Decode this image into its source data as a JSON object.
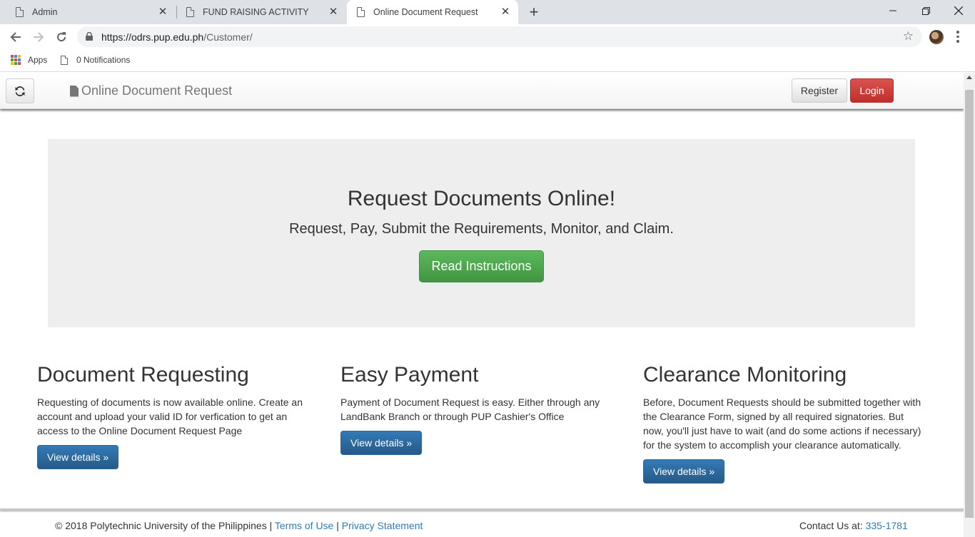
{
  "browser": {
    "tabs": [
      {
        "title": "Admin",
        "active": false
      },
      {
        "title": "FUND RAISING ACTIVITY",
        "active": false
      },
      {
        "title": "Online Document Request",
        "active": true
      }
    ],
    "url": {
      "host": "https://odrs.pup.edu.ph",
      "path": "/Customer/"
    },
    "bookmarks": {
      "apps_label": "Apps",
      "notifications_label": "0 Notifications"
    }
  },
  "navbar": {
    "brand": "Online Document Request",
    "register_label": "Register",
    "login_label": "Login"
  },
  "hero": {
    "title": "Request Documents Online!",
    "subtitle": "Request, Pay, Submit the Requirements, Monitor, and Claim.",
    "button_label": "Read Instructions"
  },
  "features": [
    {
      "title": "Document Requesting",
      "text": "Requesting of documents is now available online. Create an account and upload your valid ID for verfication to get an access to the Online Document Request Page",
      "button_label": "View details »"
    },
    {
      "title": "Easy Payment",
      "text": "Payment of Document Request is easy. Either through any LandBank Branch or through PUP Cashier's Office",
      "button_label": "View details »"
    },
    {
      "title": "Clearance Monitoring",
      "text": "Before, Document Requests should be submitted together with the Clearance Form, signed by all required signatories. But now, you'll just have to wait (and do some actions if necessary) for the system to accomplish your clearance automatically.",
      "button_label": "View details »"
    }
  ],
  "footer": {
    "copyright": "© 2018 Polytechnic University of the Philippines |",
    "terms_label": "Terms of Use",
    "separator": "|",
    "privacy_label": "Privacy Statement",
    "contact_label": "Contact Us at:",
    "contact_number": "335-1781"
  },
  "colors": {
    "primary": "#337ab7",
    "success": "#5cb85c",
    "danger": "#d9534f",
    "jumbotron_bg": "#eeeeee"
  }
}
